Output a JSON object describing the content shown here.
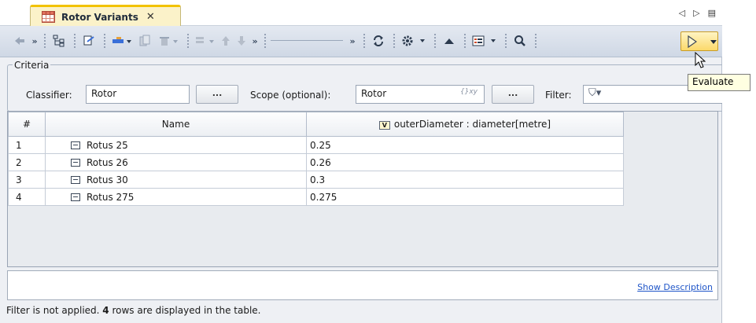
{
  "tab": {
    "title": "Rotor Variants",
    "close": "✕"
  },
  "tabnav": {
    "left": "◁",
    "right": "▷",
    "menu": "▤"
  },
  "toolbar": {
    "overflow": "»",
    "evaluate_tooltip": "Evaluate"
  },
  "criteria": {
    "legend": "Criteria",
    "classifier_label": "Classifier:",
    "classifier_value": "Rotor",
    "browse_label": "...",
    "scope_label": "Scope (optional):",
    "scope_value": "Rotor",
    "scope_expr_icon": "{}xy",
    "filter_label": "Filter:",
    "filter_icon": "⛉▾"
  },
  "table": {
    "headers": {
      "index": "#",
      "name": "Name",
      "property": "outerDiameter : diameter[metre]",
      "property_icon": "V"
    },
    "rows": [
      {
        "index": "1",
        "name": "Rotus 25",
        "value": "0.25"
      },
      {
        "index": "2",
        "name": "Rotus 26",
        "value": "0.26"
      },
      {
        "index": "3",
        "name": "Rotus 30",
        "value": "0.3"
      },
      {
        "index": "4",
        "name": "Rotus 275",
        "value": "0.275"
      }
    ]
  },
  "description": {
    "link": "Show Description"
  },
  "status": {
    "prefix": "Filter is not applied. ",
    "count": "4",
    "suffix": " rows are displayed in the table."
  },
  "colors": {
    "tab_accent": "#f2c200",
    "link": "#1f55c8",
    "evaluate_bg": "#fbd96a"
  }
}
